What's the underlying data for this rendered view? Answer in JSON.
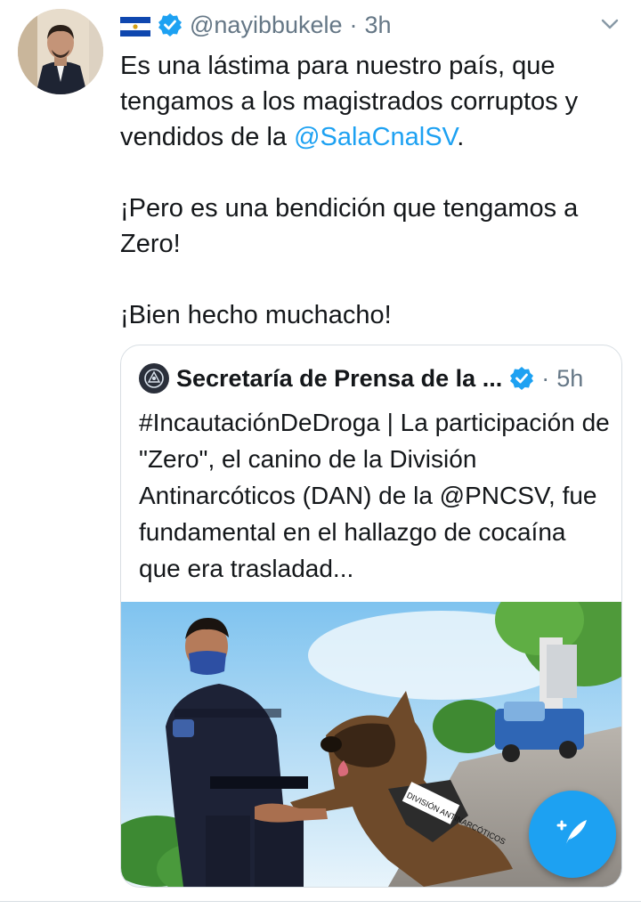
{
  "tweet": {
    "handle": "@nayibbukele",
    "separator": "·",
    "time": "3h",
    "lines": {
      "p1_a": "Es una lástima para nuestro país, que tengamos a los magistrados corruptos y vendidos de la ",
      "p1_mention": "@SalaCnalSV",
      "p1_b": ".",
      "p2": "¡Pero es una bendición que tengamos a Zero!",
      "p3": "¡Bien hecho muchacho!"
    }
  },
  "quoted": {
    "name": "Secretaría de Prensa de la ...",
    "separator": "·",
    "time": "5h",
    "text": "#IncautaciónDeDroga | La participación de \"Zero\", el canino de la División Antinarcóticos (DAN) de la @PNCSV, fue fundamental en el hallazgo de cocaína que era trasladad...",
    "image_vest_text": "DIVISIÓN ANTINARCÓTICOS"
  },
  "colors": {
    "accent": "#1da1f2",
    "text": "#14171a",
    "muted": "#657786",
    "border": "#d8dee3"
  },
  "icons": {
    "flag": "el-salvador-flag-icon",
    "verified": "verified-badge-icon",
    "chevron": "chevron-down-icon",
    "compose": "compose-tweet-icon"
  }
}
